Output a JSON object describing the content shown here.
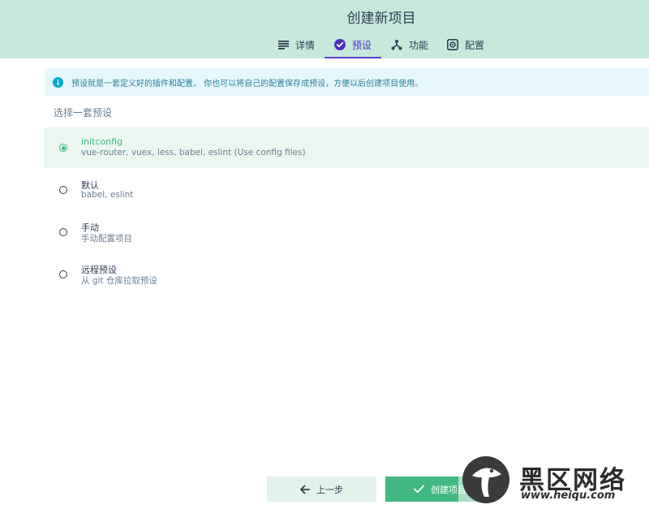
{
  "header": {
    "title": "创建新项目",
    "tabs": [
      {
        "label": "详情",
        "icon": "details-list-icon"
      },
      {
        "label": "预设",
        "icon": "check-circle-icon",
        "active": true
      },
      {
        "label": "功能",
        "icon": "features-fork-icon"
      },
      {
        "label": "配置",
        "icon": "settings-gear-icon"
      }
    ]
  },
  "info": {
    "text": "预设就是一套定义好的插件和配置。 你也可以将自己的配置保存成预设，方便以后创建项目使用。",
    "icon": "info-icon"
  },
  "presets_label": "选择一套预设",
  "presets": [
    {
      "name": "initconfig",
      "description": "vue-router, vuex, less, babel, eslint (Use config files)",
      "selected": true
    },
    {
      "name": "默认",
      "description": "babel, eslint",
      "selected": false
    },
    {
      "name": "手动",
      "description": "手动配置项目",
      "selected": false
    },
    {
      "name": "远程预设",
      "description": "从 git 仓库拉取预设",
      "selected": false
    }
  ],
  "footer": {
    "prev_label": "上一步",
    "create_label": "创建项目"
  },
  "watermark": {
    "text": "黑区网络",
    "url": "www.heiqu.com"
  },
  "colors": {
    "header_bg": "#c6e9dc",
    "accent": "#42b983",
    "active_tab": "#4f2dc7",
    "info_bg": "#e6f8fc"
  }
}
